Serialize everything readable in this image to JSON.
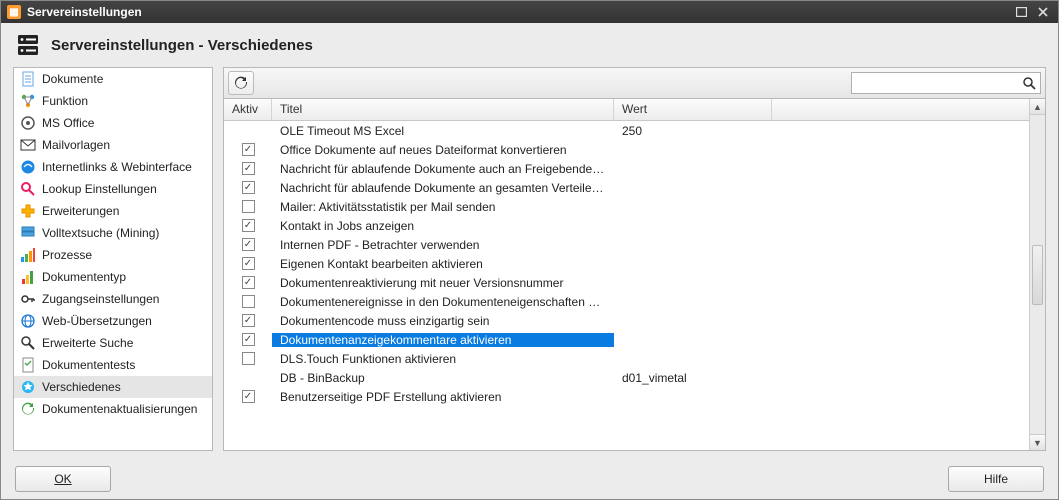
{
  "window": {
    "title": "Servereinstellungen"
  },
  "header": {
    "title": "Servereinstellungen - Verschiedenes"
  },
  "sidebar": {
    "items": [
      {
        "label": "Dokumente",
        "icon": "doc"
      },
      {
        "label": "Funktion",
        "icon": "func"
      },
      {
        "label": "MS Office",
        "icon": "office"
      },
      {
        "label": "Mailvorlagen",
        "icon": "mail"
      },
      {
        "label": "Internetlinks & Webinterface",
        "icon": "ie"
      },
      {
        "label": "Lookup Einstellungen",
        "icon": "lookup"
      },
      {
        "label": "Erweiterungen",
        "icon": "ext"
      },
      {
        "label": "Volltextsuche (Mining)",
        "icon": "mining"
      },
      {
        "label": "Prozesse",
        "icon": "proc"
      },
      {
        "label": "Dokumententyp",
        "icon": "doctype"
      },
      {
        "label": "Zugangseinstellungen",
        "icon": "key"
      },
      {
        "label": "Web-Übersetzungen",
        "icon": "web"
      },
      {
        "label": "Erweiterte Suche",
        "icon": "search"
      },
      {
        "label": "Dokumententests",
        "icon": "tests"
      },
      {
        "label": "Verschiedenes",
        "icon": "misc",
        "selected": true
      },
      {
        "label": "Dokumentenaktualisierungen",
        "icon": "refresh"
      }
    ]
  },
  "grid": {
    "columns": {
      "aktiv": "Aktiv",
      "titel": "Titel",
      "wert": "Wert"
    },
    "rows": [
      {
        "aktiv": null,
        "titel": "OLE Timeout MS Excel",
        "wert": "250"
      },
      {
        "aktiv": true,
        "titel": "Office Dokumente auf neues Dateiformat konvertieren",
        "wert": ""
      },
      {
        "aktiv": true,
        "titel": "Nachricht für ablaufende Dokumente auch an Freigebenden se...",
        "wert": ""
      },
      {
        "aktiv": true,
        "titel": "Nachricht für ablaufende Dokumente an gesamten Verteiler sen...",
        "wert": ""
      },
      {
        "aktiv": false,
        "titel": "Mailer: Aktivitätsstatistik per Mail senden",
        "wert": ""
      },
      {
        "aktiv": true,
        "titel": "Kontakt in Jobs anzeigen",
        "wert": ""
      },
      {
        "aktiv": true,
        "titel": "Internen PDF - Betrachter verwenden",
        "wert": ""
      },
      {
        "aktiv": true,
        "titel": "Eigenen Kontakt bearbeiten aktivieren",
        "wert": ""
      },
      {
        "aktiv": true,
        "titel": "Dokumentenreaktivierung mit neuer Versionsnummer",
        "wert": ""
      },
      {
        "aktiv": false,
        "titel": "Dokumentenereignisse in den Dokumenteneigenschaften ausbl...",
        "wert": ""
      },
      {
        "aktiv": true,
        "titel": "Dokumentencode muss einzigartig sein",
        "wert": ""
      },
      {
        "aktiv": true,
        "titel": "Dokumentenanzeigekommentare aktivieren",
        "wert": "",
        "selected": true
      },
      {
        "aktiv": false,
        "titel": "DLS.Touch Funktionen aktivieren",
        "wert": ""
      },
      {
        "aktiv": null,
        "titel": "DB - BinBackup",
        "wert": "d01_vimetal"
      },
      {
        "aktiv": true,
        "titel": "Benutzerseitige PDF Erstellung aktivieren",
        "wert": ""
      }
    ]
  },
  "search": {
    "placeholder": ""
  },
  "buttons": {
    "ok": "OK",
    "help": "Hilfe"
  }
}
